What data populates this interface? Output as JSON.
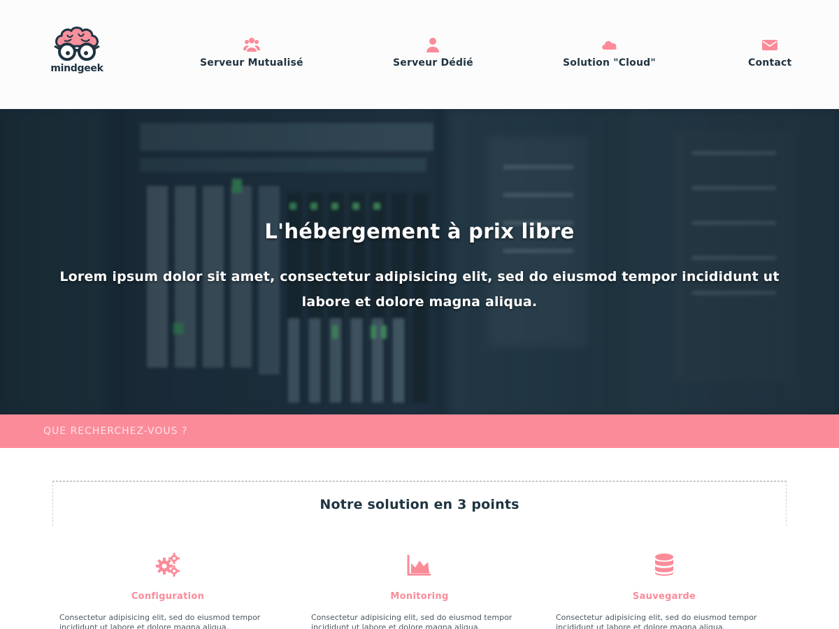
{
  "brand": {
    "name": "mindgeek"
  },
  "nav": [
    {
      "label": "Serveur Mutualisé",
      "icon": "users-icon"
    },
    {
      "label": "Serveur Dédié",
      "icon": "user-icon"
    },
    {
      "label": "Solution \"Cloud\"",
      "icon": "cloud-icon"
    },
    {
      "label": "Contact",
      "icon": "envelope-icon"
    }
  ],
  "hero": {
    "title": "L'hébergement à prix libre",
    "subtitle": "Lorem ipsum dolor sit amet, consectetur adipisicing elit, sed do eiusmod tempor incididunt ut labore et dolore magna aliqua."
  },
  "search": {
    "placeholder": "QUE RECHERCHEZ-VOUS ?"
  },
  "section": {
    "title": "Notre solution en 3 points",
    "features": [
      {
        "title": "Configuration",
        "icon": "gears-icon",
        "text": "Consectetur adipisicing elit, sed do eiusmod tempor incididunt ut labore et dolore magna aliqua."
      },
      {
        "title": "Monitoring",
        "icon": "area-chart-icon",
        "text": "Consectetur adipisicing elit, sed do eiusmod tempor incididunt ut labore et dolore magna aliqua."
      },
      {
        "title": "Sauvegarde",
        "icon": "database-icon",
        "text": "Consectetur adipisicing elit, sed do eiusmod tempor incididunt ut labore et dolore magna aliqua."
      }
    ]
  },
  "colors": {
    "accent": "#fb8b99",
    "dark": "#1f3340",
    "hero_bg": "#1b2c37"
  }
}
